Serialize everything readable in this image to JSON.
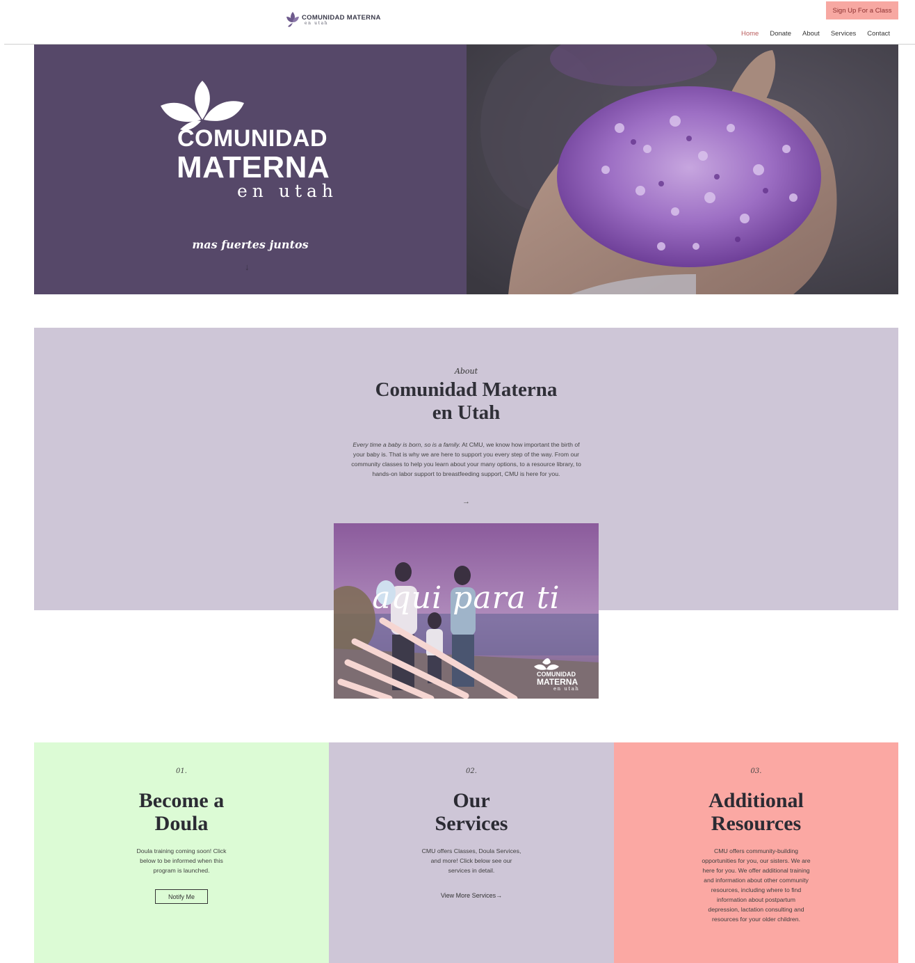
{
  "header": {
    "logo_line1": "COMUNIDAD MATERNA",
    "logo_line2": "en utah",
    "signup_label": "Sign Up For a Class",
    "nav": [
      "Home",
      "Donate",
      "About",
      "Services",
      "Contact"
    ]
  },
  "hero": {
    "logo_line1": "COMUNIDAD",
    "logo_line2": "MATERNA",
    "logo_line3": "en utah",
    "tagline": "mas fuertes juntos",
    "arrow": "↓"
  },
  "about": {
    "eyebrow": "About",
    "title_line1": "Comunidad Materna",
    "title_line2": "en Utah",
    "text_italic": "Every time a baby is born, so is a family.",
    "text_body": " At CMU, we know how important the birth of your baby is. That is why we are here to support you every step of the way. From our community classes to help you learn about your many options, to a resource library, to hands-on labor support to breastfeeding support, CMU is here for you.",
    "arrow": "→",
    "image_text": "aqui para ti",
    "image_logo_line1": "COMUNIDAD",
    "image_logo_line2": "MATERNA",
    "image_logo_line3": "en utah"
  },
  "cards": [
    {
      "number": "01.",
      "title_line1": "Become a",
      "title_line2": "Doula",
      "text": "Doula training coming soon! Click below to be informed when this program is launched.",
      "button": "Notify Me",
      "color": "#dcfbd5"
    },
    {
      "number": "02.",
      "title_line1": "Our",
      "title_line2": "Services",
      "text": "CMU offers Classes, Doula Services, and more! Click below see our services in detail.",
      "link": "View More Services→",
      "color": "#cec6d7"
    },
    {
      "number": "03.",
      "title_line1": "Additional",
      "title_line2": "Resources",
      "text": "CMU offers community-building opportunities for you, our sisters. We are here for you. We offer additional training and information about other community resources, including where to find information about postpartum depression, lactation consulting and resources for your older children.",
      "color": "#fba8a3"
    }
  ],
  "colors": {
    "hero_purple": "#564869",
    "lavender": "#cec6d7",
    "accent_pink": "#f7a8a2",
    "nav_active": "#b95b5b"
  }
}
